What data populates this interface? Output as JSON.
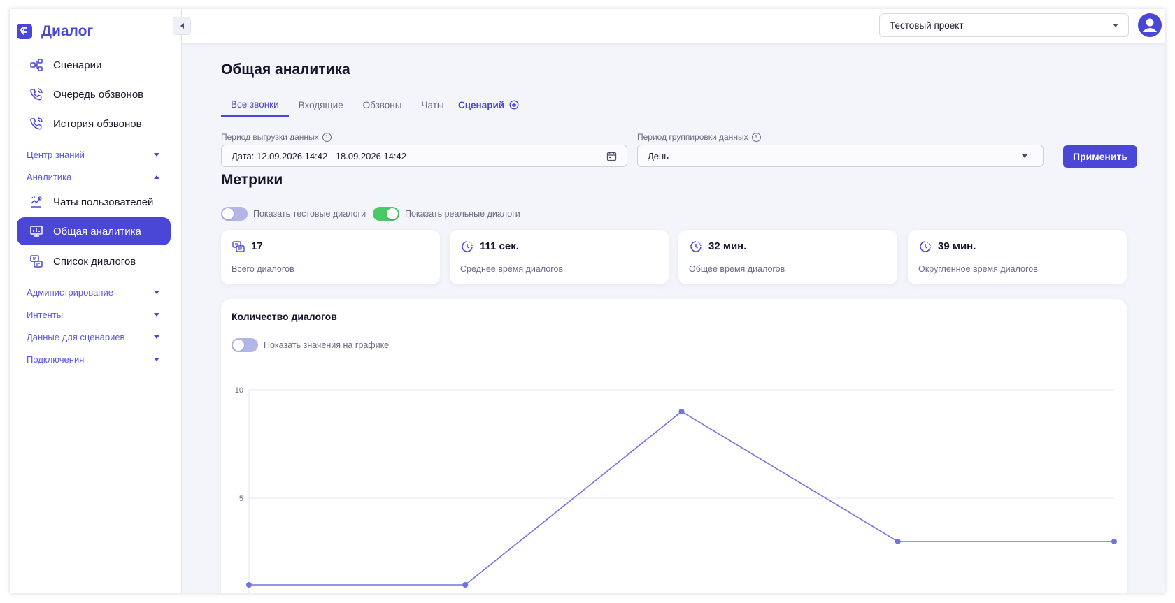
{
  "app": {
    "name": "Диалог"
  },
  "sidebar": {
    "items": [
      {
        "label": "Сценарии",
        "icon": "scenario-icon"
      },
      {
        "label": "Очередь обзвонов",
        "icon": "phone-queue-icon"
      },
      {
        "label": "История обзвонов",
        "icon": "phone-history-icon"
      }
    ],
    "groups": {
      "knowledge": "Центр знаний",
      "analytics": "Аналитика",
      "admin": "Администрирование",
      "intents": "Интенты",
      "scenario_data": "Данные для сценариев",
      "connections": "Подключения"
    },
    "analytics_items": [
      {
        "label": "Чаты пользователей",
        "icon": "user-chats-icon"
      },
      {
        "label": "Общая аналитика",
        "icon": "analytics-icon",
        "active": true
      },
      {
        "label": "Список диалогов",
        "icon": "dialog-list-icon"
      }
    ]
  },
  "header": {
    "project": "Тестовый проект"
  },
  "main": {
    "title": "Общая аналитика",
    "tabs": [
      "Все звонки",
      "Входящие",
      "Обзвоны",
      "Чаты"
    ],
    "scenario_tab": "Сценарий",
    "export_period_label": "Период выгрузки данных",
    "export_period_value": "Дата: 12.09.2026 14:42 - 18.09.2026 14:42",
    "group_period_label": "Период группировки данных",
    "group_period_value": "День",
    "apply_label": "Применить",
    "metrics_title": "Метрики",
    "toggle_test": "Показать тестовые диалоги",
    "toggle_real": "Показать реальные диалоги",
    "toggle_test_on": false,
    "toggle_real_on": true
  },
  "metrics": [
    {
      "value": "17",
      "label": "Всего диалогов",
      "icon": "dialogs-icon"
    },
    {
      "value": "111 сек.",
      "label": "Среднее время диалогов",
      "icon": "timer-icon"
    },
    {
      "value": "32 мин.",
      "label": "Общее время диалогов",
      "icon": "timer-icon"
    },
    {
      "value": "39 мин.",
      "label": "Округленное время диалогов",
      "icon": "timer-icon"
    }
  ],
  "colors": {
    "accent": "#4b47d6",
    "line": "#7472e0",
    "toggle_on": "#4ac967"
  },
  "chart_data": {
    "type": "line",
    "title": "Количество диалогов",
    "show_values_label": "Показать значения на графике",
    "show_values_on": false,
    "y_ticks": [
      "10",
      "5"
    ],
    "ylim": [
      0,
      10
    ],
    "grid": true,
    "series": [
      {
        "values": [
          1,
          1,
          9,
          3,
          3
        ]
      }
    ]
  }
}
